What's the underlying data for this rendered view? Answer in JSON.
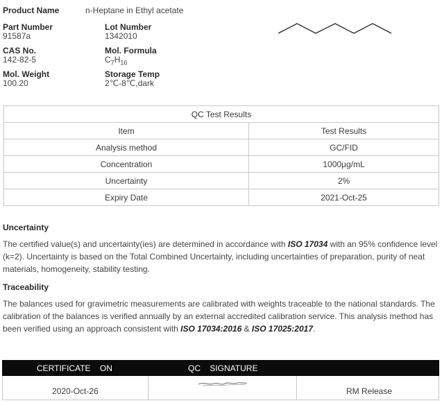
{
  "header": {
    "product_name_label": "Product Name",
    "product_name_value": "n-Heptane in Ethyl acetate",
    "part_number_label": "Part Number",
    "part_number_value": "91587a",
    "lot_number_label": "Lot Number",
    "lot_number_value": "1342010",
    "cas_label": "CAS No.",
    "cas_value": "142-82-5",
    "formula_label": "Mol. Formula",
    "formula_c": "C",
    "formula_c_sub": "7",
    "formula_h": "H",
    "formula_h_sub": "16",
    "weight_label": "Mol. Weight",
    "weight_value": "100.20",
    "storage_label": "Storage Temp",
    "storage_value": "2℃-8℃,dark"
  },
  "qc_table": {
    "caption": "QC Test Results",
    "col_item": "Item",
    "col_result": "Test Results",
    "rows": [
      {
        "item": "Analysis method",
        "result": "GC/FID"
      },
      {
        "item": "Concentration",
        "result": "1000μg/mL"
      },
      {
        "item": "Uncertainty",
        "result": "2%"
      },
      {
        "item": "Expiry Date",
        "result": "2021-Oct-25"
      }
    ]
  },
  "uncertainty": {
    "title": "Uncertainty",
    "p1": "The certified value(s) and uncertainty(ies) are determined in accordance with ",
    "p1_bold": "ISO 17034",
    "p2": " with an 95% confidence level (k=2). Uncertainty is based on the Total Combined Uncertainty, including uncertainties of preparation, purity of neat materials, homogeneity, stability testing."
  },
  "traceability": {
    "title": "Traceability",
    "p1": "The balances used for gravimetric measurements are calibrated with weights traceable to the national standards. The calibration of the balances is verified annually by an external accredited calibration service. This analysis method has been verified using an approach consistent with ",
    "b1": "ISO 17034:2016",
    "amp": " & ",
    "b2": "ISO 17025:2017",
    "end": "."
  },
  "certificate": {
    "head_left": "CERTIFICATE    ON",
    "head_mid": "QC    SIGNATURE",
    "date": "2020-Oct-26",
    "release": "RM Release"
  }
}
